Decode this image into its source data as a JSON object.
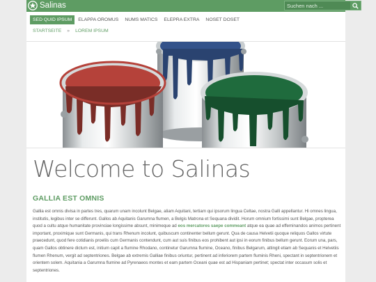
{
  "header": {
    "site_title": "Salinas",
    "search_placeholder": "Suchen nach ..."
  },
  "nav": {
    "items": [
      "SED QUID IPSUM",
      "ELAPPA OROMUS",
      "NUMS MATICS",
      "ELEPRA EXTRA",
      "NOSET DOSET"
    ],
    "active_index": 0
  },
  "breadcrumb": {
    "home": "STARTSEITE",
    "separator": "»",
    "current": "LOREM IPSUM"
  },
  "hero": {
    "paint_colors": {
      "red": "#b5423a",
      "blue": "#33528a",
      "green": "#1f6b3d"
    }
  },
  "content": {
    "title": "Welcome to Salinas",
    "section_title": "GALLIA EST OMNIS",
    "paragraph_before": "Gallia est omnis divisa in partes tres, quarum unam incolunt Belgae, aliam Aquitani, tertiam qui ipsorum lingua Celtae, nostra Galli appellantur. Hi omnes lingua, institutis, legibus inter se differunt. Gallos ab Aquitanis Garumna flumen, a Belgis Matrona et Sequana dividit. Horum omnium fortissimi sunt Belgae, propterea quod a cultu atque humanitate provinciae longissime absunt, minimeque ad",
    "paragraph_highlight": "eos mercatores saepe commeant",
    "paragraph_after": "atque ea quae ad effeminandos animos pertinent important, proximique sunt Germanis, qui trans Rhenum incolunt, quibuscum continenter bellum gerunt. Qua de causa Helvetii quoque reliquos Gallos virtute praecedunt, quod fere cotidianis proeliis cum Germanis contendunt, cum aut suis finibus eos prohibent aut ipsi in eorum finibus bellum gerunt. Eorum una, pars, quam Gallos obtinere dictum est, initium capit a flumine Rhodano, continetur Garumna flumine, Oceano, finibus Belgarum, attingit etiam ab Sequanis et Helvetiis flumen Rhenum, vergit ad septentriones. Belgae ab extremis Galliae finibus oriuntur, pertinent ad inferiorem partem fluminis Rheni, spectant in septentrionem et orientem solem. Aquitania a Garumna flumine ad Pyrenaeos montes et eam partem Oceani quae est ad Hispaniam pertinet; spectat inter occasum solis et septentriones."
  },
  "colors": {
    "accent": "#5e9c63",
    "bar": "#5e9c63"
  }
}
